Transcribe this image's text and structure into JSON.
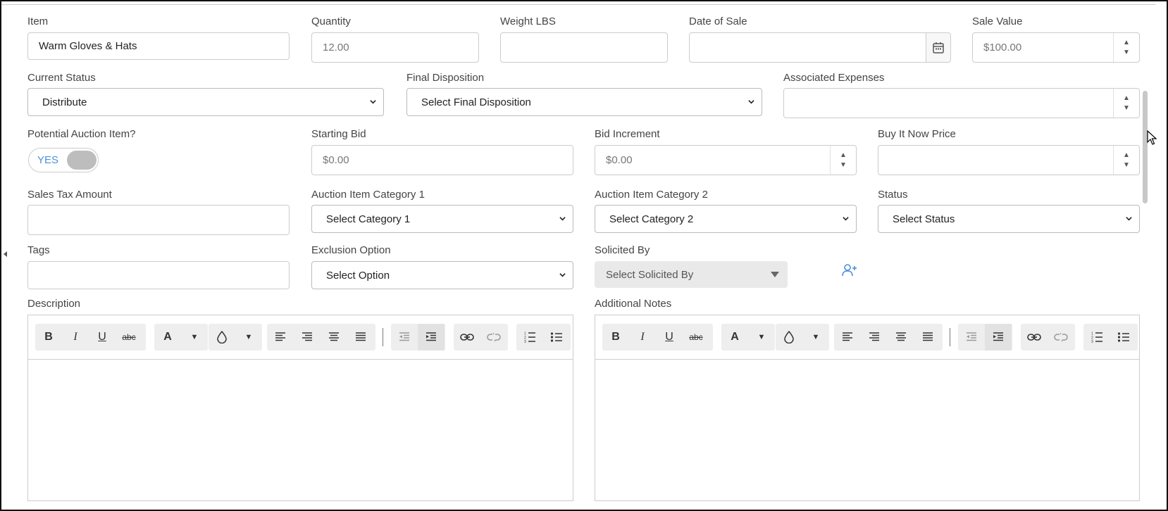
{
  "form": {
    "item": {
      "label": "Item",
      "value": "Warm Gloves & Hats"
    },
    "quantity": {
      "label": "Quantity",
      "placeholder": "12.00"
    },
    "weight": {
      "label": "Weight LBS",
      "value": ""
    },
    "date_of_sale": {
      "label": "Date of Sale",
      "value": ""
    },
    "sale_value": {
      "label": "Sale Value",
      "placeholder": "$100.00"
    },
    "current_status": {
      "label": "Current Status",
      "selected": "Distribute"
    },
    "final_disposition": {
      "label": "Final Disposition",
      "selected": "Select Final Disposition"
    },
    "associated_expenses": {
      "label": "Associated Expenses",
      "value": ""
    },
    "potential_auction": {
      "label": "Potential Auction Item?",
      "toggle_text": "YES"
    },
    "starting_bid": {
      "label": "Starting Bid",
      "placeholder": "$0.00"
    },
    "bid_increment": {
      "label": "Bid Increment",
      "placeholder": "$0.00"
    },
    "buy_it_now": {
      "label": "Buy It Now Price",
      "value": ""
    },
    "sales_tax": {
      "label": "Sales Tax Amount",
      "value": ""
    },
    "category1": {
      "label": "Auction Item Category 1",
      "selected": "Select Category 1"
    },
    "category2": {
      "label": "Auction Item Category 2",
      "selected": "Select Category 2"
    },
    "status": {
      "label": "Status",
      "selected": "Select Status"
    },
    "tags": {
      "label": "Tags",
      "value": ""
    },
    "exclusion": {
      "label": "Exclusion Option",
      "selected": "Select Option"
    },
    "solicited_by": {
      "label": "Solicited By",
      "selected": "Select Solicited By"
    },
    "description": {
      "label": "Description"
    },
    "additional_notes": {
      "label": "Additional Notes"
    }
  },
  "toolbar": {
    "bold": "B",
    "italic": "I",
    "underline": "U",
    "strike": "abc",
    "font_color": "A"
  },
  "colors": {
    "accent": "#4a90d9",
    "border": "#cccccc",
    "label": "#444444"
  }
}
